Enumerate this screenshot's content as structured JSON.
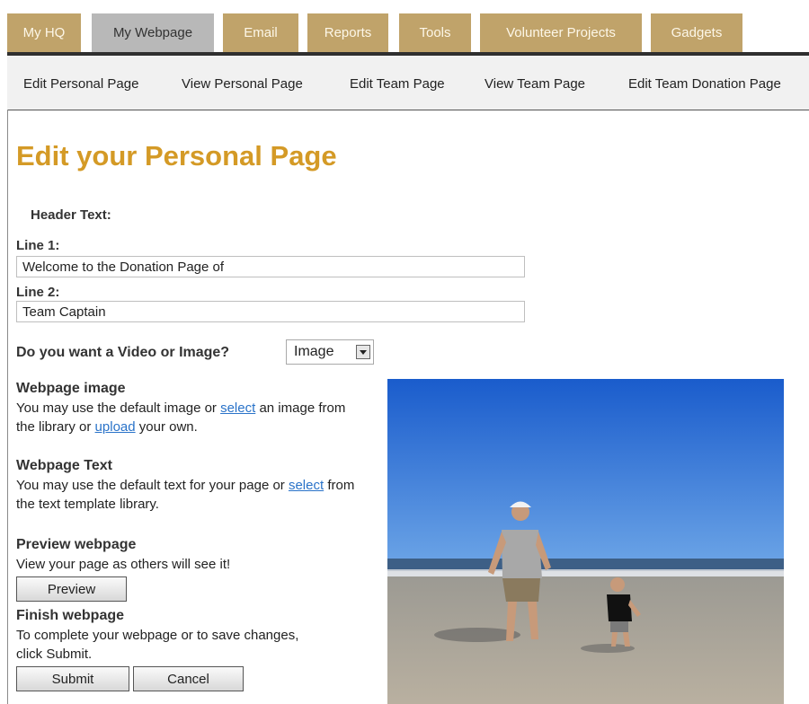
{
  "tabs": [
    {
      "label": "My HQ"
    },
    {
      "label": "My Webpage",
      "active": true
    },
    {
      "label": "Email"
    },
    {
      "label": "Reports"
    },
    {
      "label": "Tools"
    },
    {
      "label": "Volunteer Projects"
    },
    {
      "label": "Gadgets"
    }
  ],
  "subnav": [
    {
      "label": "Edit Personal Page"
    },
    {
      "label": "View Personal Page"
    },
    {
      "label": "Edit Team Page"
    },
    {
      "label": "View Team Page"
    },
    {
      "label": "Edit Team Donation Page"
    }
  ],
  "page": {
    "title": "Edit your Personal Page"
  },
  "header_text": {
    "label": "Header Text:",
    "line1_label": "Line 1:",
    "line1_value": "Welcome to the Donation Page of",
    "line2_label": "Line 2:",
    "line2_value": "Team Captain"
  },
  "media": {
    "question": "Do you want a Video or Image?",
    "selected": "Image"
  },
  "webpage_image": {
    "heading": "Webpage image",
    "text1": "You may use the default image or ",
    "link_select": "select",
    "text2": " an image from the library or ",
    "link_upload": "upload",
    "text3": " your own."
  },
  "webpage_text": {
    "heading": "Webpage Text",
    "text1": "You may use the default text for your page or ",
    "link_select": "select",
    "text2": " from the text template library."
  },
  "preview": {
    "heading": "Preview webpage",
    "text": "View your page as others will see it!",
    "button": "Preview"
  },
  "finish": {
    "heading": "Finish webpage",
    "text": "To complete your webpage or to save changes, click Submit.",
    "submit": "Submit",
    "cancel": "Cancel"
  },
  "colors": {
    "tab": "#c0a36a",
    "tab_active": "#b8b8b8",
    "title": "#d49a26",
    "link": "#2a73c9"
  }
}
